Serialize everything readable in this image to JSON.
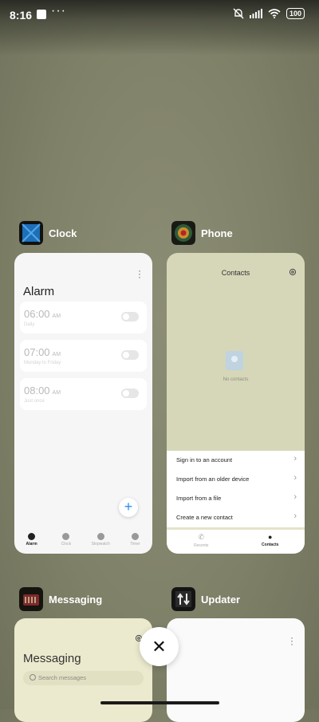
{
  "status_bar": {
    "time": "8:16",
    "dots": "···",
    "battery": "100"
  },
  "apps": {
    "clock": {
      "name": "Clock",
      "screen_title": "Alarm",
      "alarms": [
        {
          "time": "06:00",
          "ampm": "AM",
          "label": "Daily",
          "enabled": false
        },
        {
          "time": "07:00",
          "ampm": "AM",
          "label": "Monday to Friday",
          "enabled": false
        },
        {
          "time": "08:00",
          "ampm": "AM",
          "label": "Just once",
          "enabled": false
        }
      ],
      "fab": "+",
      "nav": [
        "Alarm",
        "Clock",
        "Stopwatch",
        "Timer"
      ]
    },
    "phone": {
      "name": "Phone",
      "screen_title": "Contacts",
      "empty_text": "No contacts",
      "sheet": [
        "Sign in to an account",
        "Import from an older device",
        "Import from a file",
        "Create a new contact"
      ],
      "nav": [
        "Recents",
        "Contacts"
      ]
    },
    "messaging": {
      "name": "Messaging",
      "screen_title": "Messaging",
      "search_placeholder": "Search messages"
    },
    "updater": {
      "name": "Updater"
    }
  },
  "close_button": "✕",
  "colors": {
    "accent": "#2f8cf0",
    "backdrop": "#7f8168"
  }
}
